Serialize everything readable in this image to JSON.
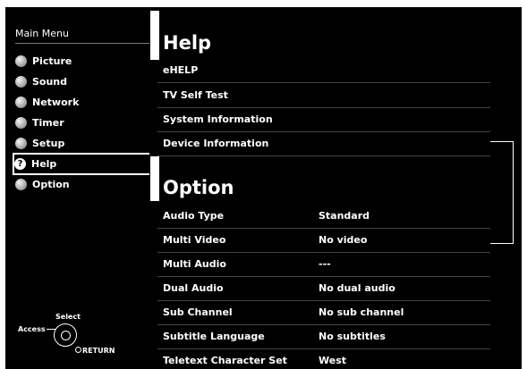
{
  "menu": {
    "title": "Main Menu",
    "items": [
      {
        "label": "Picture",
        "icon": "picture-icon"
      },
      {
        "label": "Sound",
        "icon": "sound-icon"
      },
      {
        "label": "Network",
        "icon": "network-icon"
      },
      {
        "label": "Timer",
        "icon": "timer-icon"
      },
      {
        "label": "Setup",
        "icon": "setup-icon"
      },
      {
        "label": "Help",
        "icon": "help-icon",
        "selected": true
      },
      {
        "label": "Option",
        "icon": "option-icon"
      }
    ]
  },
  "help": {
    "title": "Help",
    "items": [
      "eHELP",
      "TV Self Test",
      "System Information",
      "Device Information"
    ]
  },
  "option": {
    "title": "Option",
    "rows": [
      {
        "label": "Audio Type",
        "value": "Standard"
      },
      {
        "label": "Multi Video",
        "value": "No video"
      },
      {
        "label": "Multi Audio",
        "value": "---"
      },
      {
        "label": "Dual Audio",
        "value": "No dual audio"
      },
      {
        "label": "Sub Channel",
        "value": "No sub channel"
      },
      {
        "label": "Subtitle Language",
        "value": "No subtitles"
      },
      {
        "label": "Teletext Character Set",
        "value": "West"
      }
    ]
  },
  "nav_hint": {
    "select": "Select",
    "access": "Access",
    "return": "RETURN"
  },
  "colors": {
    "background": "#000000",
    "text": "#ffffff",
    "divider": "#444444"
  }
}
